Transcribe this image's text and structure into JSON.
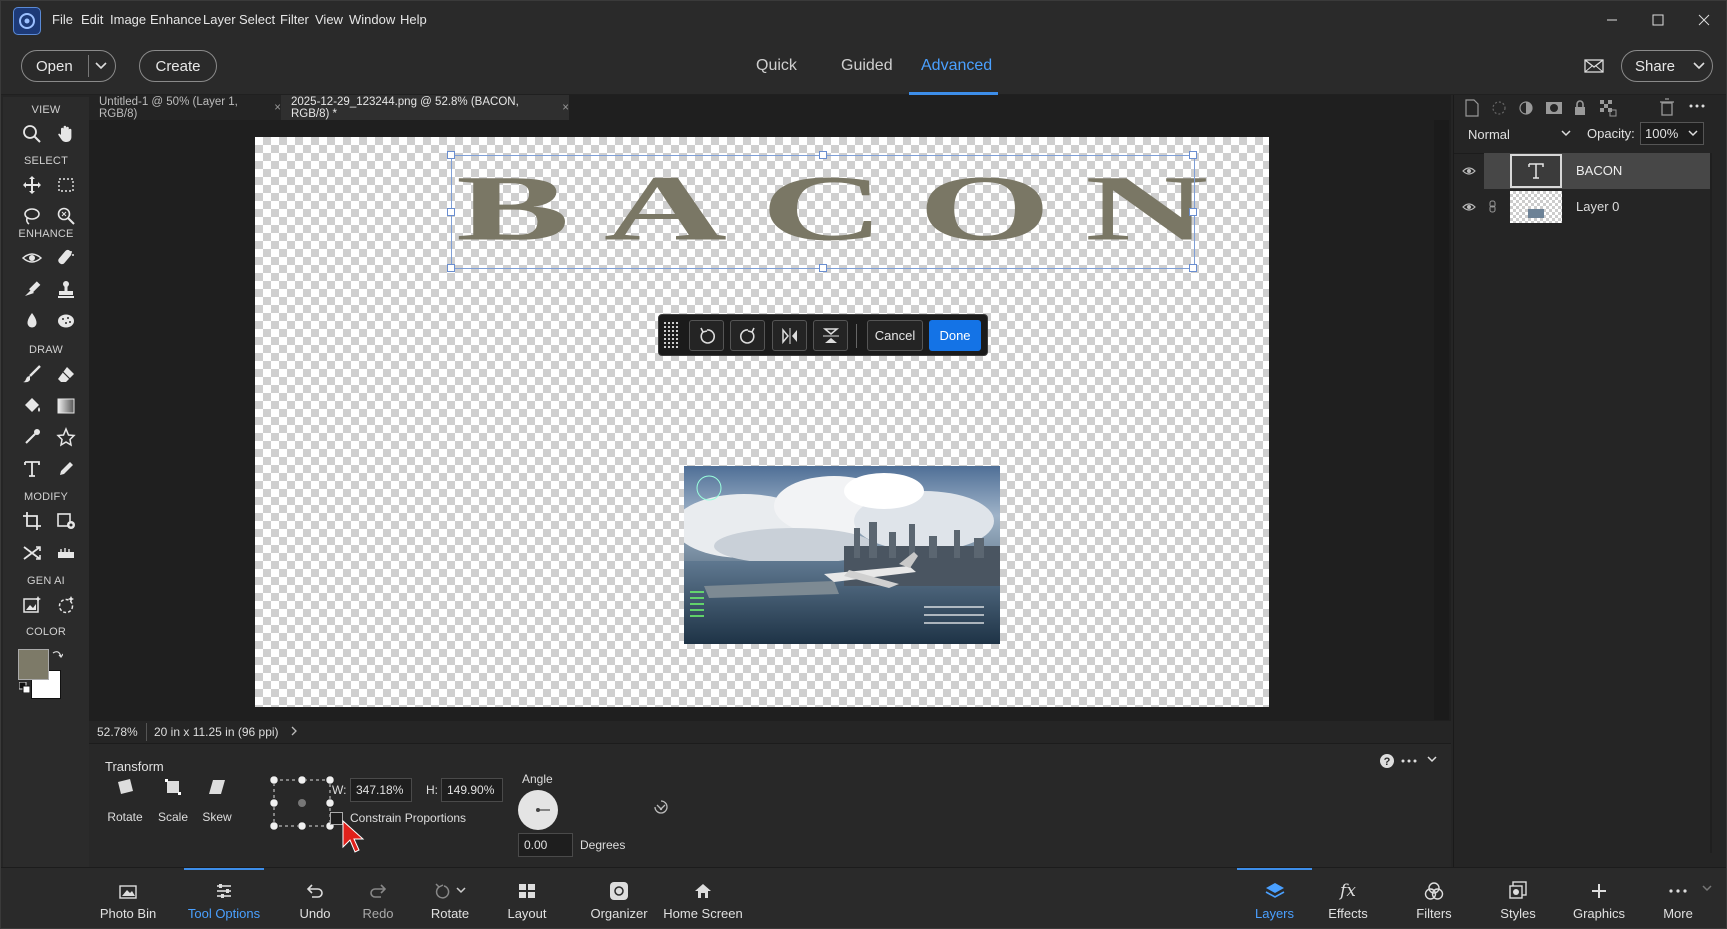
{
  "menubar": {
    "items": [
      "File",
      "Edit",
      "Image",
      "Enhance",
      "Layer",
      "Select",
      "Filter",
      "View",
      "Window",
      "Help"
    ]
  },
  "header": {
    "open_label": "Open",
    "create_label": "Create",
    "modes": [
      "Quick",
      "Guided",
      "Advanced"
    ],
    "active_mode": "Advanced",
    "share_label": "Share"
  },
  "tools": {
    "sections": [
      "VIEW",
      "SELECT",
      "ENHANCE",
      "DRAW",
      "MODIFY",
      "GEN AI",
      "COLOR"
    ],
    "foreground_color": "#7d7a68",
    "background_color": "#ffffff"
  },
  "documents": {
    "tabs": [
      {
        "title": "Untitled-1 @ 50% (Layer 1, RGB/8)",
        "close": "×"
      },
      {
        "title": "2025-12-29_123244.png @ 52.8% (BACON, RGB/8) *",
        "close": "×"
      }
    ],
    "active_tab": 1
  },
  "canvas": {
    "text_layer_content": "BACON",
    "text_color": "#7a7765"
  },
  "transform_bar": {
    "cancel_label": "Cancel",
    "done_label": "Done"
  },
  "status": {
    "zoom": "52.78%",
    "doc_size": "20 in x 11.25 in (96 ppi)"
  },
  "layers_panel": {
    "blend_mode": "Normal",
    "opacity_label": "Opacity:",
    "opacity_value": "100%",
    "layers": [
      {
        "name": "BACON",
        "type": "text",
        "selected": true
      },
      {
        "name": "Layer 0",
        "type": "image",
        "selected": false
      }
    ]
  },
  "tool_options": {
    "title": "Transform",
    "modes": [
      "Rotate",
      "Scale",
      "Skew"
    ],
    "w_label": "W:",
    "w_value": "347.18%",
    "h_label": "H:",
    "h_value": "149.90%",
    "constrain_label": "Constrain Proportions",
    "constrain_checked": false,
    "angle_label": "Angle",
    "angle_value": "0.00",
    "degrees_label": "Degrees"
  },
  "bottom_bar": {
    "left_items": [
      "Photo Bin",
      "Tool Options",
      "Undo",
      "Redo",
      "Rotate",
      "Layout",
      "Organizer",
      "Home Screen"
    ],
    "left_active": "Tool Options",
    "right_items": [
      "Layers",
      "Effects",
      "Filters",
      "Styles",
      "Graphics",
      "More"
    ],
    "right_active": "Layers"
  },
  "colors": {
    "accent": "#3d8eea",
    "done_button": "#1473e6"
  }
}
